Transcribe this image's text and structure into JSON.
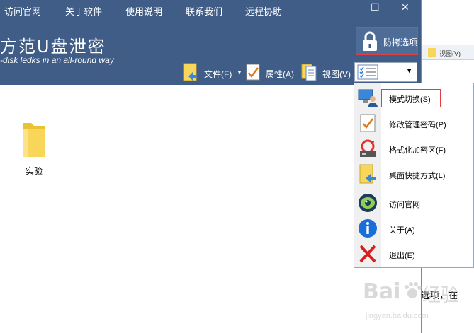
{
  "menubar": {
    "items": [
      "访问官网",
      "关于软件",
      "使用说明",
      "联系我们",
      "远程协助"
    ]
  },
  "window_controls": {
    "minimize": "—",
    "maximize": "☐",
    "close": "✕"
  },
  "header": {
    "title": "方范U盘泄密",
    "subtitle": "-disk ledks in an all-round way",
    "protect_label": "防拷选项"
  },
  "toolbar": {
    "file_label": "文件(F)",
    "property_label": "属性(A)",
    "view_label": "视图(V)"
  },
  "right_panel": {
    "tab_label": "视图(V)"
  },
  "content": {
    "folder_label": "实验"
  },
  "dropdown": {
    "items": [
      {
        "label": "模式切换(S)",
        "icon": "monitor-user-icon"
      },
      {
        "label": "修改管理密码(P)",
        "icon": "checklist-icon"
      },
      {
        "label": "格式化加密区(F)",
        "icon": "format-drive-icon"
      },
      {
        "label": "桌面快捷方式(L)",
        "icon": "shortcut-icon"
      },
      {
        "label": "访问官网",
        "icon": "eye-icon"
      },
      {
        "label": "关于(A)",
        "icon": "info-icon"
      },
      {
        "label": "退出(E)",
        "icon": "exit-x-icon"
      }
    ]
  },
  "bottom_text": "选项，在",
  "watermark": {
    "brand": "Bai",
    "brand2": "经验",
    "url": "jingyan.baidu.com"
  },
  "colors": {
    "header_bg": "#3f5d87",
    "highlight_border": "#e04040",
    "accent_blue": "#1a6ed8"
  }
}
